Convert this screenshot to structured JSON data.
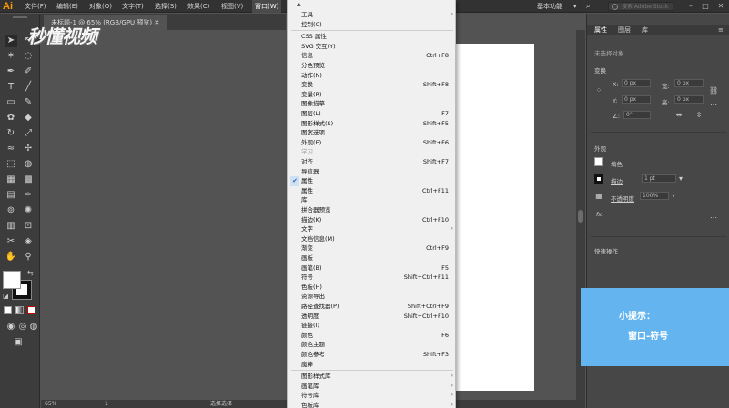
{
  "app": {
    "logo": "Ai"
  },
  "menubar": {
    "items": [
      "文件(F)",
      "编辑(E)",
      "对象(O)",
      "文字(T)",
      "选择(S)",
      "效果(C)",
      "视图(V)",
      "窗口(W)"
    ],
    "workspace": "基本功能",
    "search_placeholder": "搜索 Adobe Stock"
  },
  "document": {
    "tab_title": "未标题-1 @ 65% (RGB/GPU 预览)"
  },
  "watermark": "秒懂视频",
  "window_menu": {
    "items": [
      {
        "label": "工具",
        "shortcut": "",
        "submenu": true
      },
      {
        "label": "控制(C)",
        "shortcut": ""
      },
      {
        "label": "CSS 属性",
        "shortcut": ""
      },
      {
        "label": "SVG 交互(Y)",
        "shortcut": ""
      },
      {
        "label": "信息",
        "shortcut": "Ctrl+F8"
      },
      {
        "label": "分色预览",
        "shortcut": ""
      },
      {
        "label": "动作(N)",
        "shortcut": ""
      },
      {
        "label": "变换",
        "shortcut": "Shift+F8"
      },
      {
        "label": "变量(R)",
        "shortcut": ""
      },
      {
        "label": "图像描摹",
        "shortcut": ""
      },
      {
        "label": "图层(L)",
        "shortcut": "F7"
      },
      {
        "label": "图形样式(S)",
        "shortcut": "Shift+F5"
      },
      {
        "label": "图案选项",
        "shortcut": ""
      },
      {
        "label": "外观(E)",
        "shortcut": "Shift+F6"
      },
      {
        "label": "学习",
        "shortcut": "",
        "disabled": true
      },
      {
        "label": "对齐",
        "shortcut": "Shift+F7"
      },
      {
        "label": "导航器",
        "shortcut": ""
      },
      {
        "label": "属性",
        "shortcut": "",
        "checked": true
      },
      {
        "label": "属性",
        "shortcut": "Ctrl+F11"
      },
      {
        "label": "库",
        "shortcut": ""
      },
      {
        "label": "拼合器预览",
        "shortcut": ""
      },
      {
        "label": "描边(K)",
        "shortcut": "Ctrl+F10"
      },
      {
        "label": "文字",
        "shortcut": "",
        "submenu": true
      },
      {
        "label": "文档信息(M)",
        "shortcut": ""
      },
      {
        "label": "渐变",
        "shortcut": "Ctrl+F9"
      },
      {
        "label": "画板",
        "shortcut": ""
      },
      {
        "label": "画笔(B)",
        "shortcut": "F5"
      },
      {
        "label": "符号",
        "shortcut": "Shift+Ctrl+F11"
      },
      {
        "label": "色板(H)",
        "shortcut": ""
      },
      {
        "label": "资源导出",
        "shortcut": ""
      },
      {
        "label": "路径查找器(P)",
        "shortcut": "Shift+Ctrl+F9"
      },
      {
        "label": "透明度",
        "shortcut": "Shift+Ctrl+F10"
      },
      {
        "label": "链接(I)",
        "shortcut": ""
      },
      {
        "label": "颜色",
        "shortcut": "F6"
      },
      {
        "label": "颜色主题",
        "shortcut": ""
      },
      {
        "label": "颜色参考",
        "shortcut": "Shift+F3"
      },
      {
        "label": "魔棒",
        "shortcut": ""
      },
      {
        "label": "图形样式库",
        "shortcut": "",
        "submenu": true
      },
      {
        "label": "画笔库",
        "shortcut": "",
        "submenu": true
      },
      {
        "label": "符号库",
        "shortcut": "",
        "submenu": true
      },
      {
        "label": "色板库",
        "shortcut": "",
        "submenu": true
      }
    ]
  },
  "right_panel": {
    "tabs": [
      "属性",
      "图层",
      "库"
    ],
    "no_selection": "未选择对象",
    "transform_title": "变换",
    "x_label": "X:",
    "y_label": "Y:",
    "w_label": "宽:",
    "h_label": "高:",
    "angle_label": "∠:",
    "x_value": "0 px",
    "y_value": "0 px",
    "w_value": "0 px",
    "h_value": "0 px",
    "angle_value": "0°",
    "appearance_title": "外观",
    "fill_label": "填色",
    "stroke_label": "描边",
    "stroke_value": "1 pt",
    "opacity_label": "不透明度",
    "opacity_value": "100%",
    "fx_label": "fx.",
    "quick_actions_title": "快速操作"
  },
  "statusbar": {
    "zoom": "65%",
    "page": "1",
    "tool": "选择选择"
  },
  "tip": {
    "title": "小提示：",
    "body": "窗口-符号"
  },
  "colors": {
    "tip_bg": "#63b4ef",
    "logo": "#ff9a00",
    "menu_bg": "#f0f0f0",
    "ui_dark": "#535353"
  }
}
